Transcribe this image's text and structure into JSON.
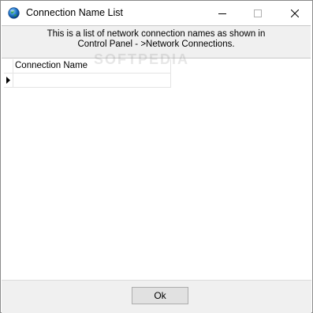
{
  "window": {
    "title": "Connection Name List",
    "controls": {
      "minimize": "minimize",
      "maximize": "maximize",
      "close": "close"
    }
  },
  "description": {
    "line1": "This is a list of network connection names as shown in",
    "line2": "Control Panel - >Network Connections."
  },
  "grid": {
    "columns": [
      "Connection Name"
    ],
    "rows": [
      [
        ""
      ]
    ]
  },
  "footer": {
    "ok_label": "Ok"
  },
  "watermark": "SOFTPEDIA",
  "colors": {
    "titlebar": "#ffffff",
    "panel": "#f0f0f0",
    "button": "#e1e1e1",
    "button_border": "#adadad"
  }
}
